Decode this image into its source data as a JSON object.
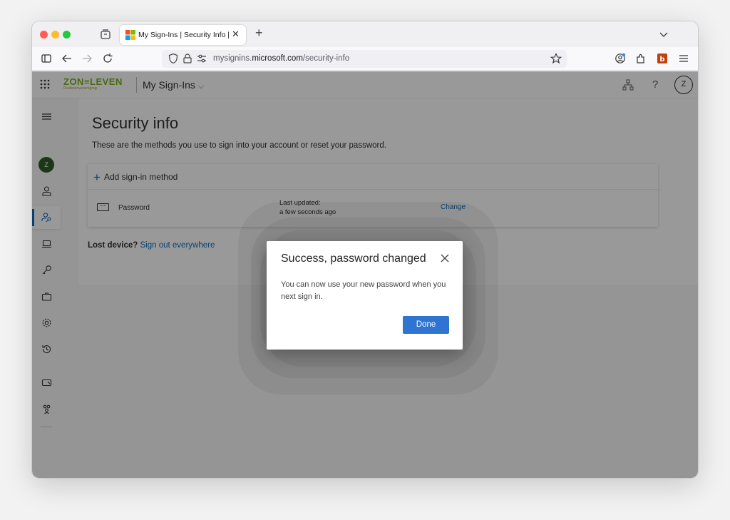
{
  "browser": {
    "tab_title": "My Sign-Ins | Security Info | Mic",
    "url_prefix": "mysignins.",
    "url_domain": "microsoft.com",
    "url_path": "/security-info"
  },
  "app": {
    "logo_main": "ZON≡LEVEN",
    "logo_sub": "Ouderenvereniging",
    "title": "My Sign-Ins",
    "avatar_initial": "Z",
    "sidebar_avatar_initial": "Z"
  },
  "page": {
    "heading": "Security info",
    "subtitle": "These are the methods you use to sign into your account or reset your password.",
    "add_method_label": "Add sign-in method",
    "method_name": "Password",
    "last_updated_label": "Last updated:",
    "last_updated_value": "a few seconds ago",
    "change_label": "Change",
    "lost_device_label": "Lost device?",
    "sign_out_label": "Sign out everywhere"
  },
  "dialog": {
    "title": "Success, password changed",
    "body": "You can now use your new password when you next sign in.",
    "done_label": "Done"
  },
  "colors": {
    "accent": "#0f6cbd",
    "button": "#2f74d0",
    "logo_green": "#7ab319",
    "sidebar_avatar": "#2e5e26"
  }
}
